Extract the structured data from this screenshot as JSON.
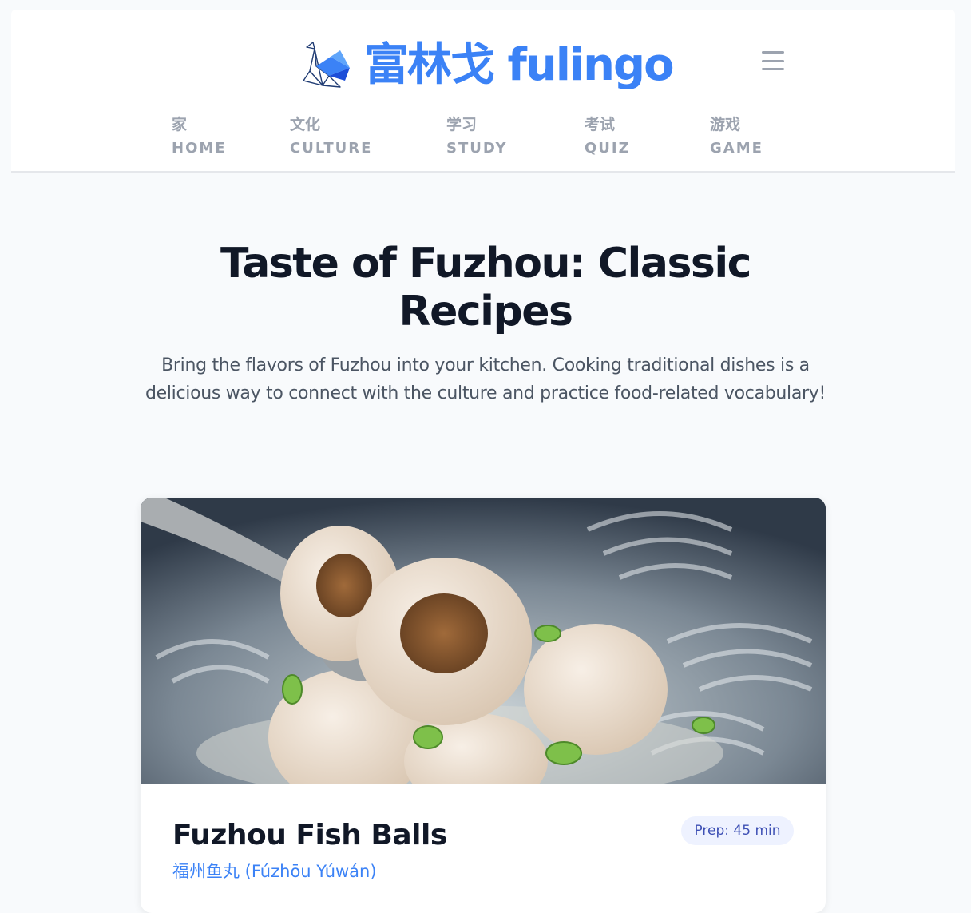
{
  "brand": {
    "name": "富林戈 fulingo",
    "color": "#3b82f6"
  },
  "header": {
    "menu_icon": "hamburger-menu-icon"
  },
  "nav": [
    {
      "zh": "家",
      "en": "HOME"
    },
    {
      "zh": "文化",
      "en": "CULTURE"
    },
    {
      "zh": "学习",
      "en": "STUDY"
    },
    {
      "zh": "考试",
      "en": "QUIZ"
    },
    {
      "zh": "游戏",
      "en": "GAME"
    }
  ],
  "hero": {
    "title": "Taste of Fuzhou: Classic Recipes",
    "subtitle": "Bring the flavors of Fuzhou into your kitchen. Cooking traditional dishes is a delicious way to connect with the culture and practice food-related vocabulary!"
  },
  "recipe": {
    "title": "Fuzhou Fish Balls",
    "subtitle": "福州鱼丸 (Fúzhōu Yúwán)",
    "prep": "Prep: 45 min",
    "image": "fish-balls-in-soup-photo"
  }
}
